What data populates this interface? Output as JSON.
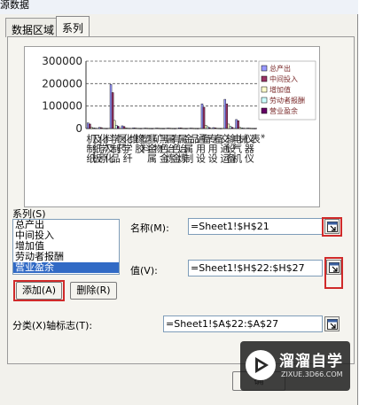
{
  "window": {
    "title": "源数据"
  },
  "tabs": [
    {
      "label": "数据区域",
      "active": false
    },
    {
      "label": "系列",
      "active": true
    }
  ],
  "chart_data": {
    "type": "bar",
    "ylim": [
      0,
      300000
    ],
    "y_ticks": [
      "0",
      "100000",
      "200000",
      "300000"
    ],
    "grid": true,
    "legend_position": "right",
    "categories": [
      "机制纸及纸板",
      "化学原料及化学制品",
      "化学纤维",
      "医药",
      "橡胶",
      "塑料",
      "非金属矿物",
      "黑色金属冶炼",
      "有色金属冶炼",
      "金属制品",
      "通用设备",
      "专用设备",
      "交通运输设备",
      "电气机械",
      "仪器仪表"
    ],
    "tick_labels": [
      "机制纸",
      "及纸板",
      "化学原",
      "料及化",
      "学制品",
      "医药",
      "化学纤",
      "维",
      "橡胶",
      "塑料",
      "非金属",
      "矿物",
      "黑色金",
      "属冶炼",
      "有色金",
      "属冶炼",
      "金属制",
      "品",
      "通用设",
      "备",
      "专用设",
      "备",
      "交通运",
      "输设备",
      "电气机",
      "械",
      "仪器仪",
      "表",
      "*"
    ],
    "series": [
      {
        "name": "总产出",
        "color": "#9999ff",
        "values": [
          25000,
          5000,
          196000,
          12000,
          3000,
          2000,
          2000,
          2000,
          3000,
          2000,
          110000,
          4000,
          130000,
          40000,
          2000
        ]
      },
      {
        "name": "中间投入",
        "color": "#993366",
        "values": [
          20000,
          4000,
          160000,
          9000,
          2000,
          1500,
          1500,
          1500,
          2500,
          1500,
          95000,
          3000,
          110000,
          35000,
          1500
        ]
      },
      {
        "name": "增加值",
        "color": "#ffffcc",
        "values": [
          5000,
          1000,
          36000,
          3000,
          1000,
          500,
          500,
          500,
          500,
          500,
          15000,
          1000,
          20000,
          5000,
          500
        ]
      },
      {
        "name": "劳动者报酬",
        "color": "#ccffff",
        "values": [
          3000,
          500,
          15000,
          1500,
          500,
          300,
          300,
          300,
          300,
          300,
          8000,
          500,
          10000,
          3000,
          300
        ]
      },
      {
        "name": "营业盈余",
        "color": "#660066",
        "values": [
          1500,
          300,
          10000,
          800,
          300,
          200,
          200,
          200,
          200,
          200,
          4000,
          300,
          5000,
          1500,
          200
        ]
      }
    ]
  },
  "series_section": {
    "label": "系列(S)",
    "items": [
      "总产出",
      "中间投入",
      "增加值",
      "劳动者报酬",
      "营业盈余"
    ],
    "selected_index": 4
  },
  "buttons": {
    "add": "添加(A)",
    "remove": "删除(R)",
    "bottom": "确"
  },
  "fields": {
    "name_label": "名称(M):",
    "name_value": "=Sheet1!$H$21",
    "values_label": "值(V):",
    "values_value": "=Sheet1!$H$22:$H$27",
    "category_label": "分类(X)轴标志(T):",
    "category_value": "=Sheet1!$A$22:$A$27"
  },
  "watermark": {
    "title": "溜溜自学",
    "subtitle": "ZIXUE.3D66.COM"
  },
  "icons": {
    "range_picker": "range-picker-icon"
  }
}
